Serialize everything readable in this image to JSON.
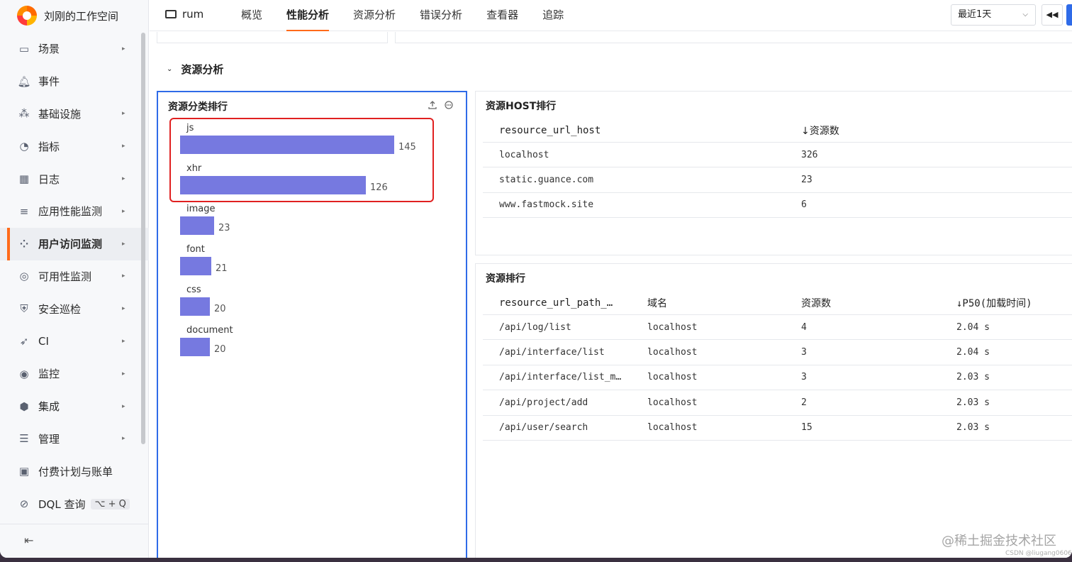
{
  "workspace": {
    "title": "刘刚的工作空间"
  },
  "sidebar": {
    "items": [
      {
        "label": "场景",
        "icon": "monitor-icon",
        "arrow": true
      },
      {
        "label": "事件",
        "icon": "bell-icon",
        "arrow": false
      },
      {
        "label": "基础设施",
        "icon": "cubes-icon",
        "arrow": true
      },
      {
        "label": "指标",
        "icon": "metric-icon",
        "arrow": true
      },
      {
        "label": "日志",
        "icon": "calendar-icon",
        "arrow": true
      },
      {
        "label": "应用性能监测",
        "icon": "filter-icon",
        "arrow": true
      },
      {
        "label": "用户访问监测",
        "icon": "apps-icon",
        "arrow": true,
        "active": true
      },
      {
        "label": "可用性监测",
        "icon": "signal-icon",
        "arrow": true
      },
      {
        "label": "安全巡检",
        "icon": "shield-icon",
        "arrow": true
      },
      {
        "label": "CI",
        "icon": "rocket-icon",
        "arrow": true
      },
      {
        "label": "监控",
        "icon": "radar-icon",
        "arrow": true
      },
      {
        "label": "集成",
        "icon": "box-icon",
        "arrow": true
      },
      {
        "label": "管理",
        "icon": "sliders-icon",
        "arrow": true
      },
      {
        "label": "付费计划与账单",
        "icon": "bill-icon",
        "arrow": false
      }
    ],
    "dql": {
      "label": "DQL 查询",
      "shortcut": "⌥ + Q"
    }
  },
  "topbar": {
    "app": "rum",
    "tabs": [
      {
        "label": "概览",
        "active": false
      },
      {
        "label": "性能分析",
        "active": true
      },
      {
        "label": "资源分析",
        "active": false
      },
      {
        "label": "错误分析",
        "active": false
      },
      {
        "label": "查看器",
        "active": false
      },
      {
        "label": "追踪",
        "active": false
      }
    ],
    "time_range": "最近1天"
  },
  "section": {
    "title": "资源分析"
  },
  "category_panel": {
    "title": "资源分类排行"
  },
  "chart_data": {
    "type": "bar",
    "orientation": "horizontal",
    "title": "资源分类排行",
    "categories": [
      "js",
      "xhr",
      "image",
      "font",
      "css",
      "document"
    ],
    "values": [
      145,
      126,
      23,
      21,
      20,
      20
    ],
    "color": "#7679e0"
  },
  "host_panel": {
    "title": "资源HOST排行",
    "columns": [
      "resource_url_host",
      "↓资源数"
    ],
    "rows": [
      [
        "localhost",
        "326"
      ],
      [
        "static.guance.com",
        "23"
      ],
      [
        "www.fastmock.site",
        "6"
      ]
    ]
  },
  "resource_panel": {
    "title": "资源排行",
    "columns": [
      "resource_url_path_…",
      "域名",
      "资源数",
      "↓P50(加载时间)"
    ],
    "rows": [
      [
        "/api/log/list",
        "localhost",
        "4",
        "2.04 s"
      ],
      [
        "/api/interface/list",
        "localhost",
        "3",
        "2.04 s"
      ],
      [
        "/api/interface/list_m…",
        "localhost",
        "3",
        "2.03 s"
      ],
      [
        "/api/project/add",
        "localhost",
        "2",
        "2.03 s"
      ],
      [
        "/api/user/search",
        "localhost",
        "15",
        "2.03 s"
      ]
    ]
  },
  "watermark": {
    "text": "@稀土掘金技术社区",
    "sub": "CSDN @liugang0606"
  },
  "colors": {
    "accent": "#ff6a1a",
    "primary": "#2f6be8",
    "bar": "#7679e0",
    "highlight": "#e02020"
  }
}
